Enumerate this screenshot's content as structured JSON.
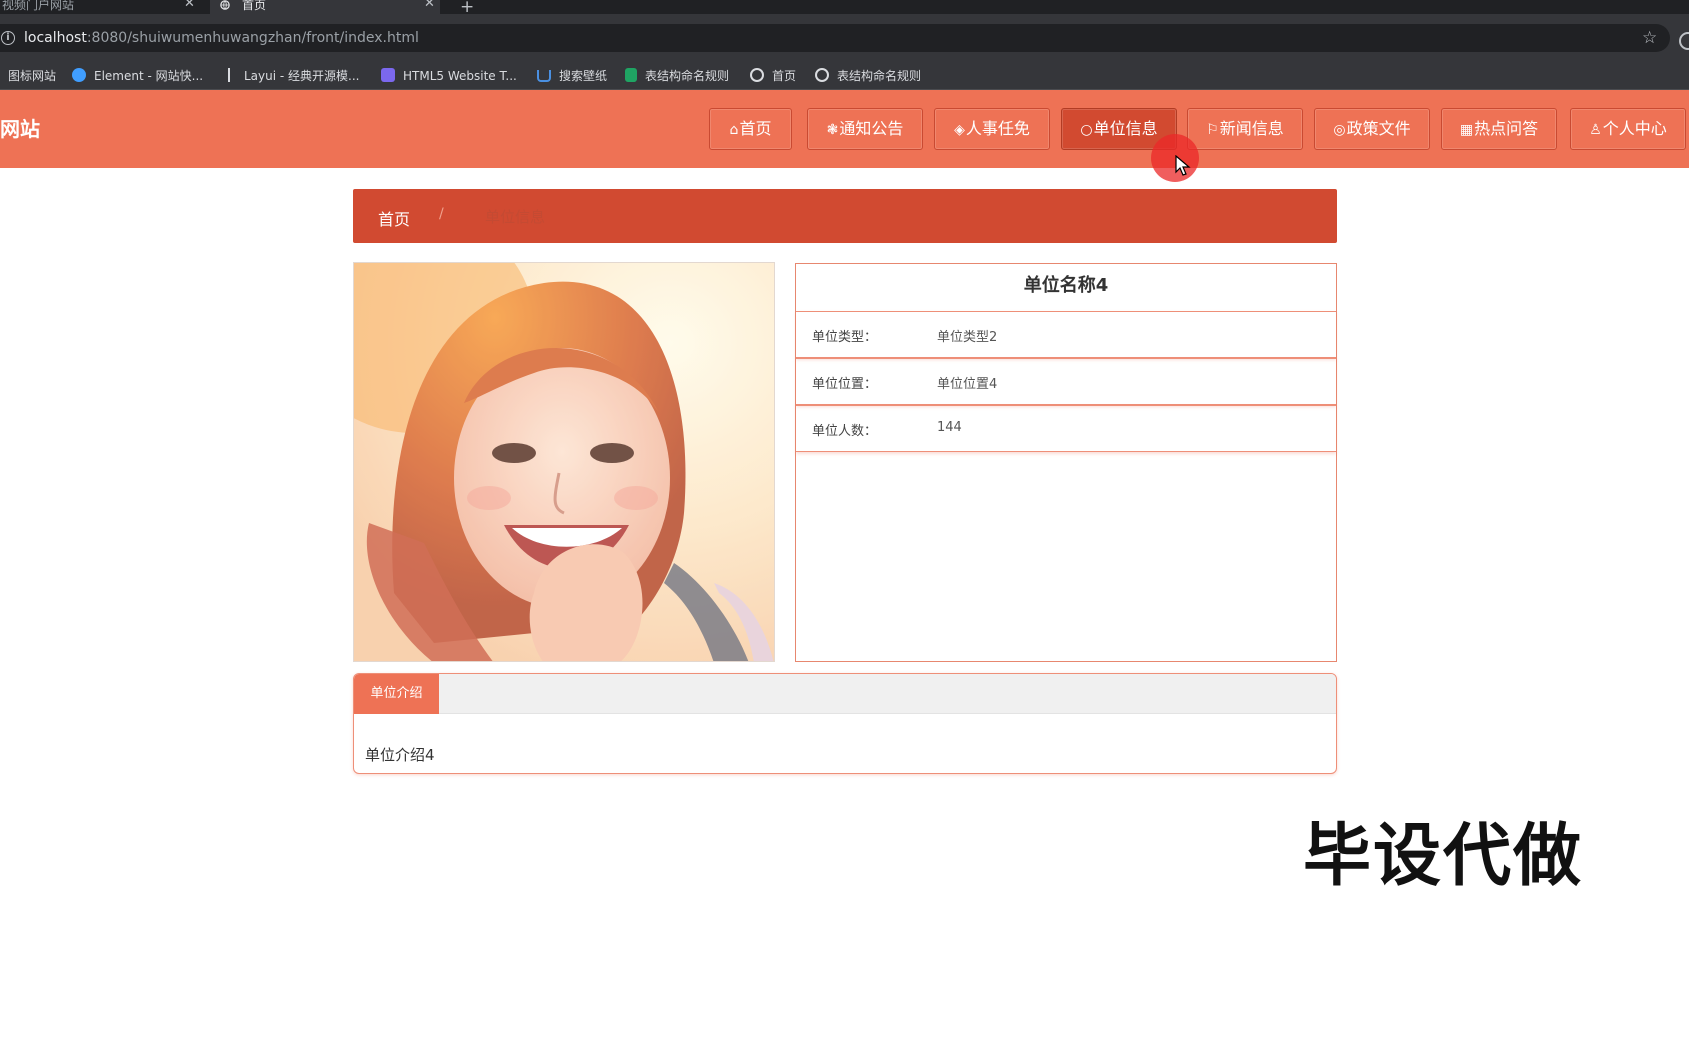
{
  "browser": {
    "tabs": [
      {
        "label": "视频门户网站",
        "active": false
      },
      {
        "label": "首页",
        "active": true
      }
    ],
    "url_host": "localhost",
    "url_path": ":8080/shuiwumenhuwangzhan/front/index.html",
    "bookmarks": [
      {
        "label": "图标网站",
        "icon": "none"
      },
      {
        "label": "Element - 网站快...",
        "icon": "element-icon",
        "color": "#409eff"
      },
      {
        "label": "Layui - 经典开源模...",
        "icon": "layui-icon",
        "color": "#dadce0"
      },
      {
        "label": "HTML5 Website T...",
        "icon": "html5-icon",
        "color": "#7b68ee"
      },
      {
        "label": "搜索壁纸",
        "icon": "wallpaper-icon",
        "color": "#4a90e2"
      },
      {
        "label": "表结构命名规则",
        "icon": "sheet-icon",
        "color": "#1fa463"
      },
      {
        "label": "首页",
        "icon": "globe-icon",
        "color": "#dadce0"
      },
      {
        "label": "表结构命名规则",
        "icon": "globe-icon",
        "color": "#dadce0"
      }
    ]
  },
  "site": {
    "title": "网站",
    "accent": "#ee7255",
    "nav": [
      {
        "icon": "⌂",
        "label": "首页"
      },
      {
        "icon": "❃",
        "label": "通知公告"
      },
      {
        "icon": "◈",
        "label": "人事任免"
      },
      {
        "icon": "○",
        "label": "单位信息",
        "active": true
      },
      {
        "icon": "⚐",
        "label": "新闻信息"
      },
      {
        "icon": "◎",
        "label": "政策文件"
      },
      {
        "icon": "▦",
        "label": "热点问答"
      },
      {
        "icon": "♙",
        "label": "个人中心"
      }
    ]
  },
  "breadcrumb": {
    "home": "首页",
    "separator": "/",
    "current": "单位信息"
  },
  "detail": {
    "name": "单位名称4",
    "rows": [
      {
        "label": "单位类型：",
        "value": "单位类型2"
      },
      {
        "label": "单位位置：",
        "value": "单位位置4"
      },
      {
        "label": "单位人数：",
        "value": "144"
      }
    ]
  },
  "intro": {
    "tab_label": "单位介绍",
    "content": "单位介绍4"
  },
  "watermark": "毕设代做"
}
